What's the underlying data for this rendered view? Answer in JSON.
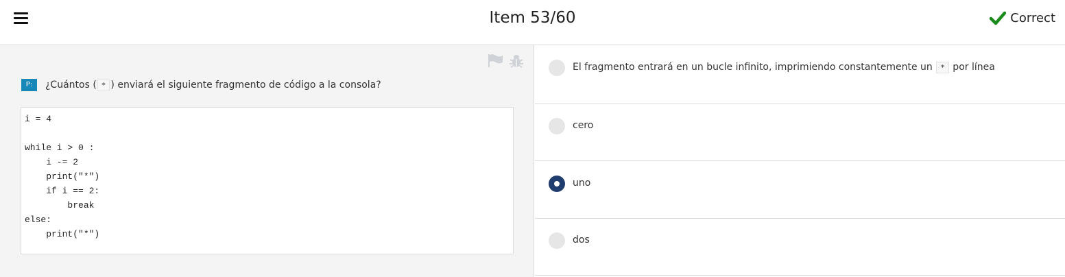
{
  "header": {
    "title": "Item 53/60",
    "status_label": "Correct",
    "status_color": "#1a8a1a",
    "menu_icon": "hamburger-icon",
    "status_icon": "check-icon"
  },
  "question": {
    "badge": "P:",
    "text_before": "¿Cuántos (",
    "inline_code": "*",
    "text_after": ") enviará el siguiente fragmento de código a la consola?",
    "code": "i = 4\n\nwhile i > 0 :\n    i -= 2\n    print(\"*\")\n    if i == 2:\n        break\nelse:\n    print(\"*\")",
    "tool_icons": [
      "flag-icon",
      "bug-icon"
    ]
  },
  "options": [
    {
      "text_before": "El fragmento entrará en un bucle infinito, imprimiendo constantemente un ",
      "inline_code": "*",
      "text_after": " por línea",
      "selected": false
    },
    {
      "text_before": "cero",
      "inline_code": "",
      "text_after": "",
      "selected": false
    },
    {
      "text_before": "uno",
      "inline_code": "",
      "text_after": "",
      "selected": true
    },
    {
      "text_before": "dos",
      "inline_code": "",
      "text_after": "",
      "selected": false
    }
  ],
  "colors": {
    "badge": "#1888b8",
    "selected_radio": "#1f3d6e",
    "panel_background": "#f4f4f4"
  }
}
